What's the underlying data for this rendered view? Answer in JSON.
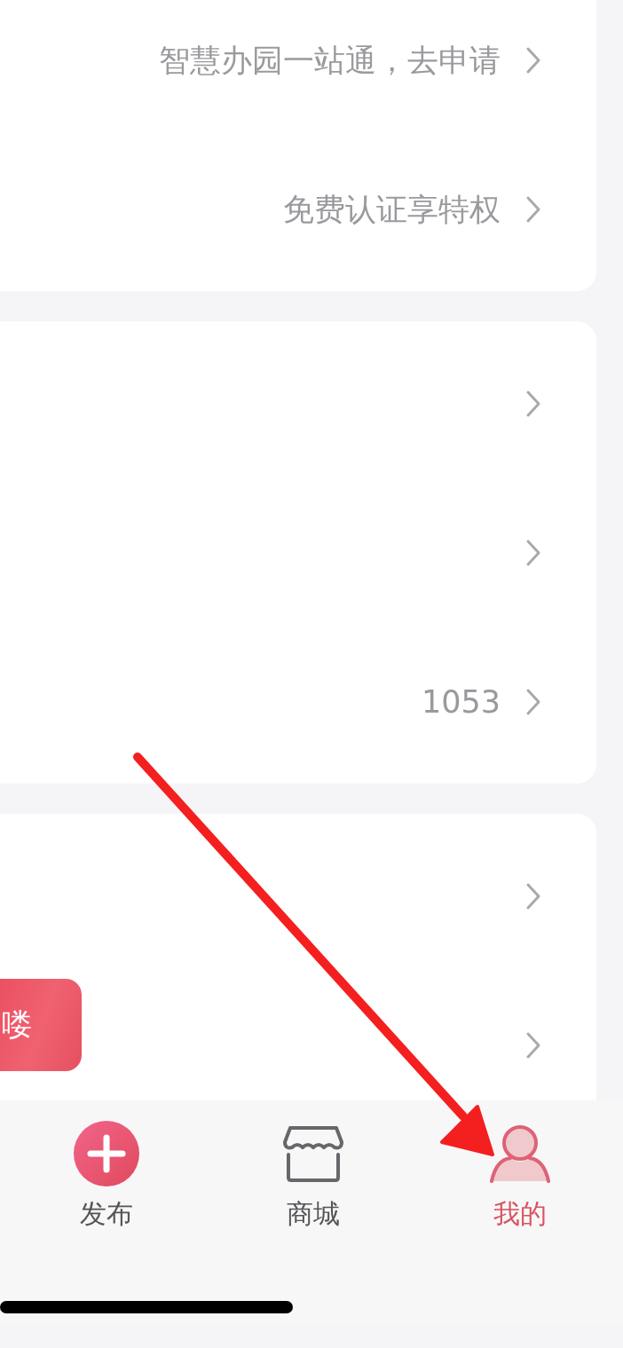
{
  "cards": [
    {
      "rows": [
        {
          "kind": "value",
          "value": "智慧办园一站通，去申请"
        },
        {
          "kind": "value",
          "value": "免费认证享特权"
        }
      ]
    },
    {
      "rows": [
        {
          "kind": "plain"
        },
        {
          "kind": "plain"
        },
        {
          "kind": "value",
          "value": "1053"
        }
      ]
    },
    {
      "rows": [
        {
          "kind": "plain"
        },
        {
          "kind": "plain"
        }
      ]
    }
  ],
  "floating_button": {
    "label": "喽"
  },
  "tab_bar": [
    {
      "label": "发布",
      "kind": "plus",
      "selected": false
    },
    {
      "label": "商城",
      "kind": "shop",
      "selected": false
    },
    {
      "label": "我的",
      "kind": "person",
      "selected": true
    }
  ]
}
